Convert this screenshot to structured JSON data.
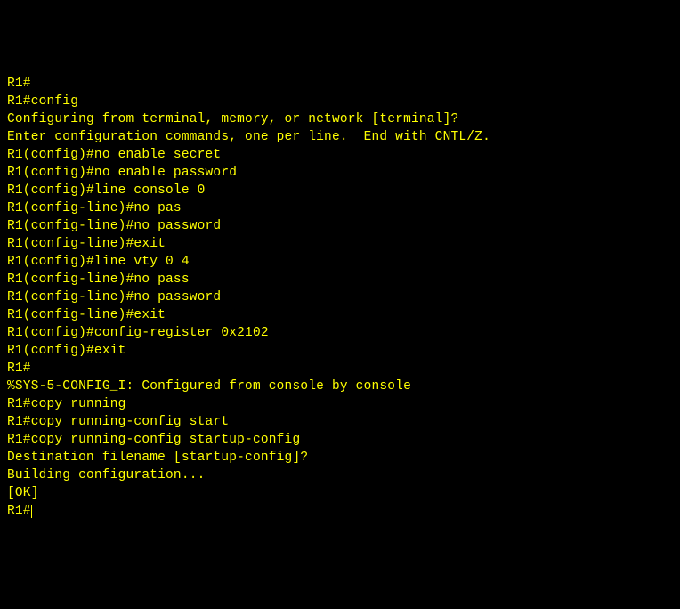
{
  "lines": [
    "R1#",
    "R1#config",
    "Configuring from terminal, memory, or network [terminal]?",
    "Enter configuration commands, one per line.  End with CNTL/Z.",
    "R1(config)#no enable secret",
    "R1(config)#no enable password",
    "R1(config)#line console 0",
    "R1(config-line)#no pas",
    "R1(config-line)#no password",
    "R1(config-line)#exit",
    "R1(config)#line vty 0 4",
    "R1(config-line)#no pass",
    "R1(config-line)#no password",
    "R1(config-line)#exit",
    "R1(config)#config-register 0x2102",
    "R1(config)#exit",
    "R1#",
    "%SYS-5-CONFIG_I: Configured from console by console",
    "",
    "R1#copy running",
    "R1#copy running-config start",
    "R1#copy running-config startup-config",
    "Destination filename [startup-config]?",
    "Building configuration...",
    "[OK]",
    "R1#"
  ]
}
